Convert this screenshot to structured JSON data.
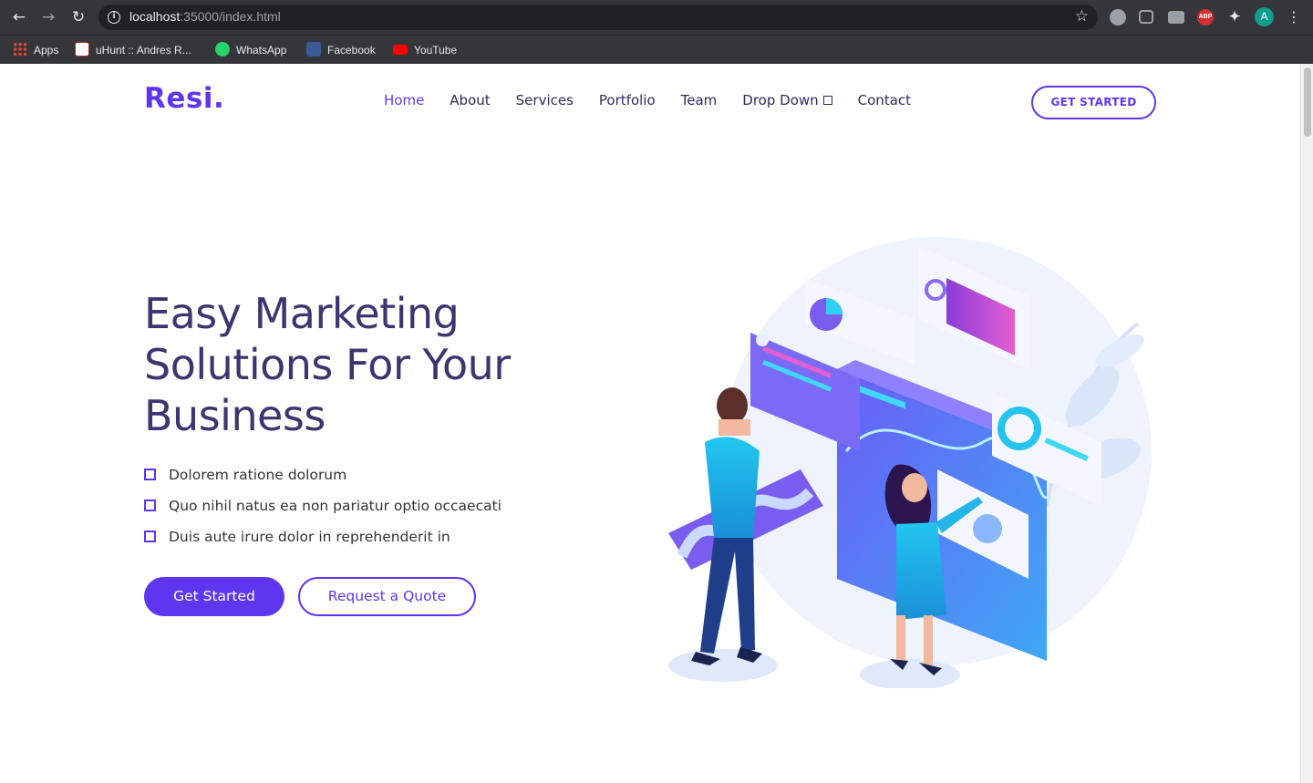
{
  "browser": {
    "url_host": "localhost",
    "url_rest": ":35000/index.html",
    "bookmarks": [
      {
        "label": "Apps",
        "icon": "apps-grid-icon"
      },
      {
        "label": "uHunt :: Andres R...",
        "icon": "uhunt-icon"
      },
      {
        "label": "WhatsApp",
        "icon": "whatsapp-icon"
      },
      {
        "label": "Facebook",
        "icon": "facebook-icon"
      },
      {
        "label": "YouTube",
        "icon": "youtube-icon"
      }
    ],
    "extensions": [
      "discord-icon",
      "pocket-icon",
      "camera-icon",
      "abp-icon",
      "puzzle-icon"
    ],
    "abp_label": "ABP",
    "profile_initial": "A"
  },
  "header": {
    "logo": "Resi.",
    "nav": [
      {
        "label": "Home",
        "active": true
      },
      {
        "label": "About"
      },
      {
        "label": "Services"
      },
      {
        "label": "Portfolio"
      },
      {
        "label": "Team"
      },
      {
        "label": "Drop Down",
        "dropdown": true
      },
      {
        "label": "Contact"
      }
    ],
    "cta": "GET STARTED"
  },
  "hero": {
    "title_lines": [
      "Easy Marketing",
      "Solutions For Your",
      "Business"
    ],
    "features": [
      "Dolorem ratione dolorum",
      "Quo nihil natus ea non pariatur optio occaecati",
      "Duis aute irure dolor in reprehenderit in"
    ],
    "primary_button": "Get Started",
    "secondary_button": "Request a Quote"
  },
  "colors": {
    "accent": "#5e36f0",
    "heading": "#3d3470",
    "chrome_dark": "#35363a"
  }
}
